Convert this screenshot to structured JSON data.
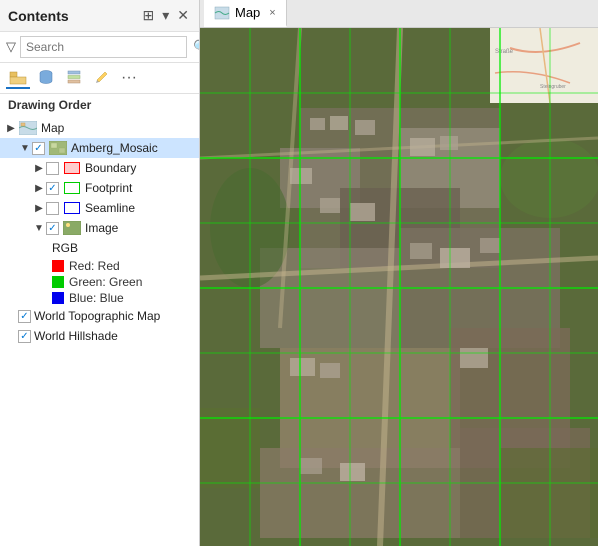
{
  "sidebar": {
    "title": "Contents",
    "search_placeholder": "Search",
    "toolbar_icons": [
      "folder",
      "database",
      "layer",
      "pencil",
      "more"
    ],
    "section_label": "Drawing Order",
    "layers": [
      {
        "id": "map",
        "label": "Map",
        "level": 0,
        "expanded": true,
        "has_checkbox": false,
        "icon": "map"
      },
      {
        "id": "amberg",
        "label": "Amberg_Mosaic",
        "level": 1,
        "expanded": true,
        "has_checkbox": true,
        "checked": true,
        "selected": true
      },
      {
        "id": "boundary",
        "label": "Boundary",
        "level": 2,
        "expanded": false,
        "has_checkbox": true,
        "checked": false,
        "swatch": "red"
      },
      {
        "id": "footprint",
        "label": "Footprint",
        "level": 2,
        "expanded": false,
        "has_checkbox": true,
        "checked": true,
        "swatch": "green-outline"
      },
      {
        "id": "seamline",
        "label": "Seamline",
        "level": 2,
        "expanded": false,
        "has_checkbox": false,
        "swatch": "blue-outline"
      },
      {
        "id": "image",
        "label": "Image",
        "level": 2,
        "expanded": true,
        "has_checkbox": true,
        "checked": true
      },
      {
        "id": "rgb_label",
        "label": "RGB",
        "level": 3,
        "type": "label"
      },
      {
        "id": "rgb_red",
        "label": "Red:  Red",
        "level": 3,
        "type": "rgb",
        "color": "red"
      },
      {
        "id": "rgb_green",
        "label": "Green:  Green",
        "level": 3,
        "type": "rgb",
        "color": "green"
      },
      {
        "id": "rgb_blue",
        "label": "Blue:  Blue",
        "level": 3,
        "type": "rgb",
        "color": "blue"
      },
      {
        "id": "world_topo",
        "label": "World Topographic Map",
        "level": 0,
        "has_checkbox": true,
        "checked": true
      },
      {
        "id": "world_hillshade",
        "label": "World Hillshade",
        "level": 0,
        "has_checkbox": true,
        "checked": true
      }
    ]
  },
  "map_tab": {
    "label": "Map",
    "close_label": "×"
  }
}
